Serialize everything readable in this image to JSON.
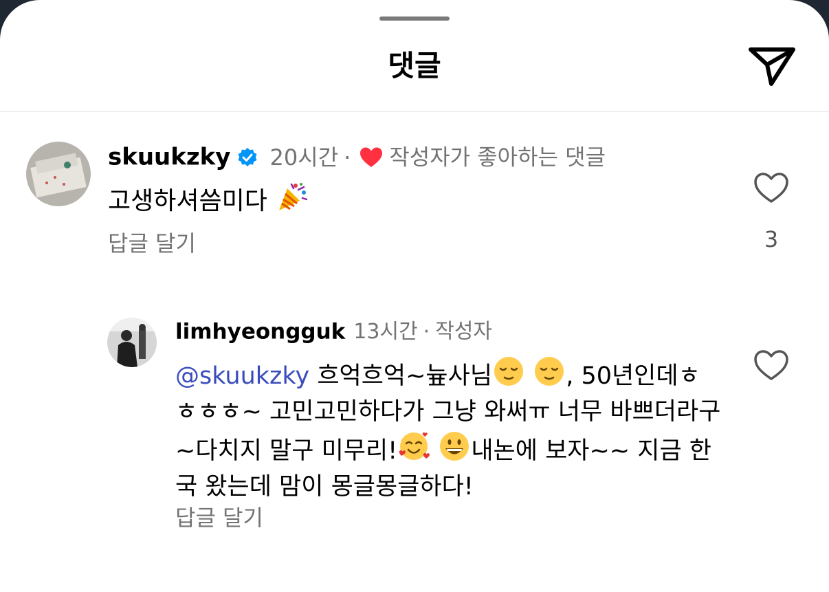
{
  "header": {
    "title": "댓글",
    "send_icon": "paper-plane-icon"
  },
  "comments": [
    {
      "username": "skuukzky",
      "verified": true,
      "time": "20시간",
      "separator": "·",
      "author_like_label": "작성자가 좋아하는 댓글",
      "text": "고생하셔씀미다",
      "emoji": "party-popper",
      "reply_label": "답글 달기",
      "like_count": "3"
    },
    {
      "username": "limhyeongguk",
      "time": "13시간",
      "separator": "·",
      "author_badge": "작성자",
      "mention": "@skuukzky",
      "text_parts": [
        "흐억흐억~늎사님",
        ", 50년인데ㅎ ㅎㅎㅎ~ 고민고민하다가 그냥 와써ㅠ 너무 바쁘더라구~다치지 말구 미무리!",
        "내논에 보자~~ 지금 한국 왔는데 맘이 몽글몽글하다!"
      ],
      "emojis": [
        "relieved-face",
        "relieved-face",
        "smiling-face-with-hearts",
        "grinning-face"
      ],
      "reply_label": "답글 달기"
    }
  ],
  "colors": {
    "mention": "#3b4dbd",
    "heart": "#ff3040",
    "verified": "#0095f6",
    "secondary_text": "#737373"
  }
}
